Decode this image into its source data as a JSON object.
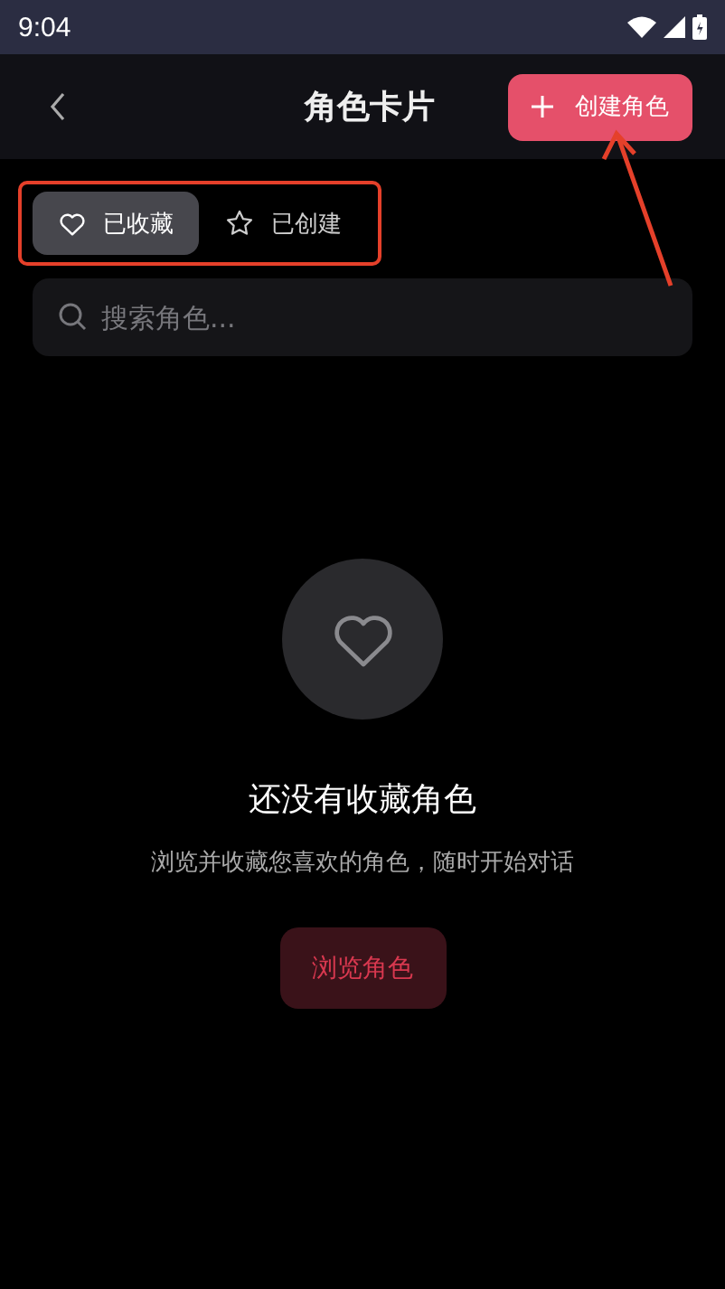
{
  "status_bar": {
    "time": "9:04"
  },
  "header": {
    "title": "角色卡片",
    "action": "创建角色"
  },
  "tabs": [
    {
      "label": "已收藏",
      "selected": true
    },
    {
      "label": "已创建",
      "selected": false
    }
  ],
  "search": {
    "placeholder": "搜索角色..."
  },
  "empty_state": {
    "title": "还没有收藏角色",
    "message": "浏览并收藏您喜欢的角色，随时开始对话",
    "button": "浏览角色"
  }
}
